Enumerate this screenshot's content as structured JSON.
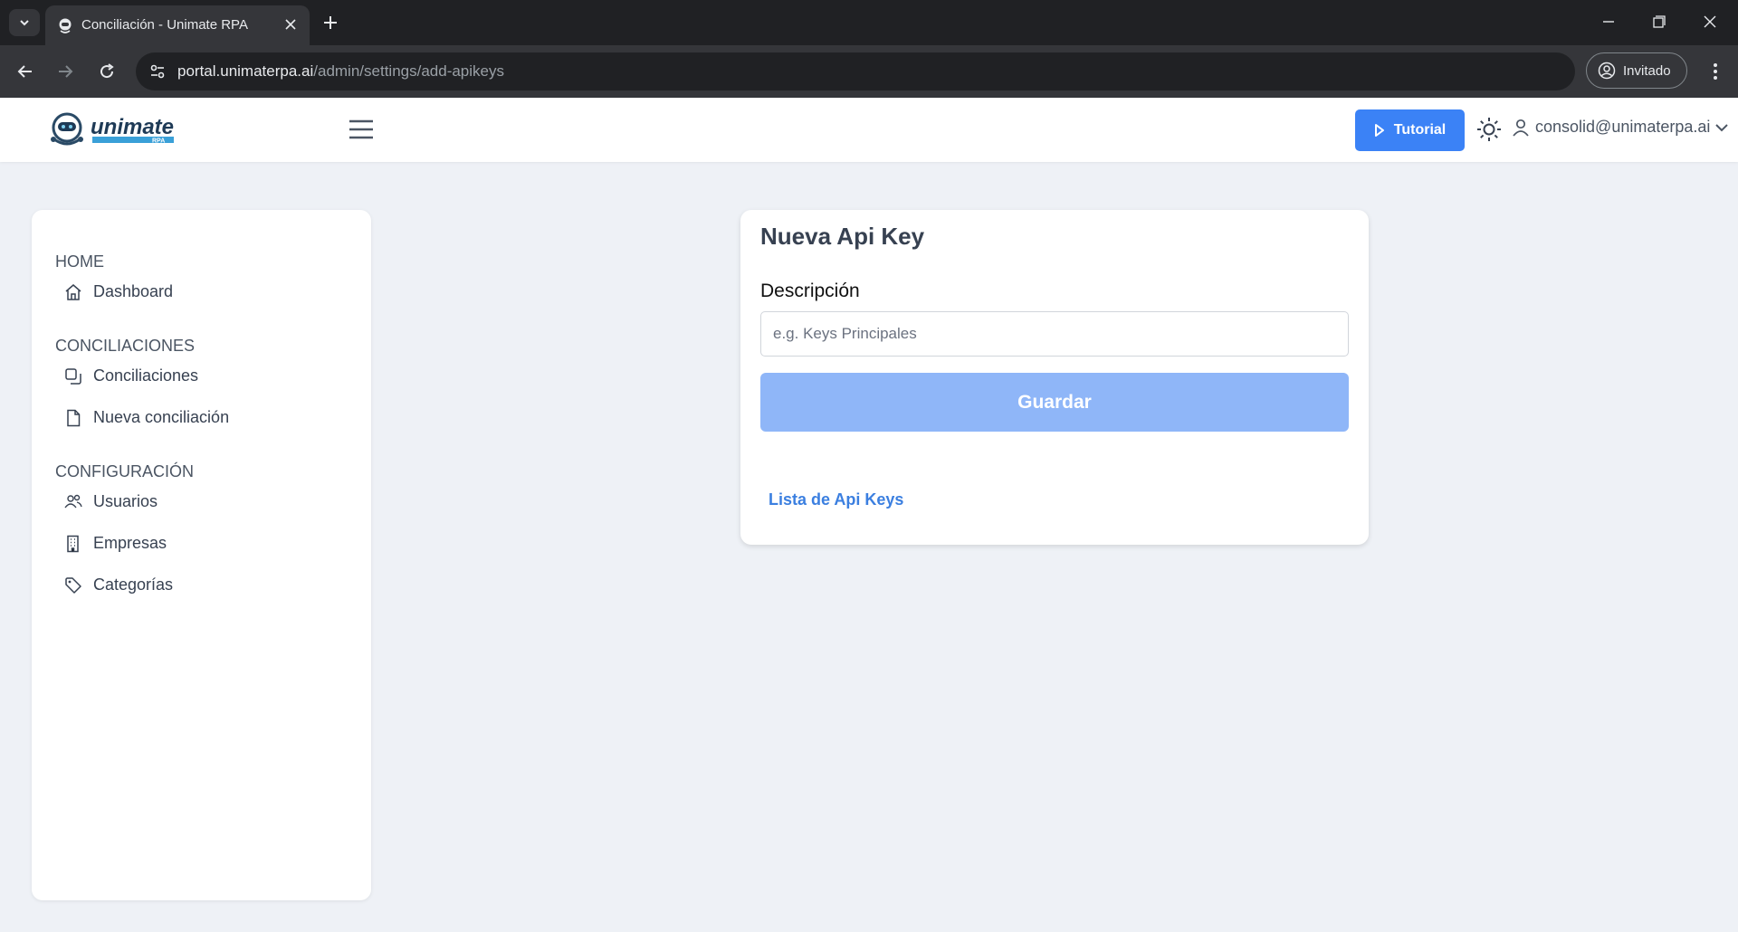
{
  "browser": {
    "tab_title": "Conciliación - Unimate RPA",
    "url_host": "portal.unimaterpa.ai",
    "url_path": "/admin/settings/add-apikeys",
    "profile_label": "Invitado"
  },
  "header": {
    "logo_text": "unimate",
    "logo_subtext": "RPA",
    "tutorial_label": "Tutorial",
    "user_email": "consolid@unimaterpa.ai"
  },
  "sidebar": {
    "sections": [
      {
        "title": "HOME",
        "items": [
          {
            "label": "Dashboard",
            "icon": "home-icon"
          }
        ]
      },
      {
        "title": "CONCILIACIONES",
        "items": [
          {
            "label": "Conciliaciones",
            "icon": "copy-icon"
          },
          {
            "label": "Nueva conciliación",
            "icon": "file-icon"
          }
        ]
      },
      {
        "title": "CONFIGURACIÓN",
        "items": [
          {
            "label": "Usuarios",
            "icon": "users-icon"
          },
          {
            "label": "Empresas",
            "icon": "building-icon"
          },
          {
            "label": "Categorías",
            "icon": "tag-icon"
          }
        ]
      }
    ]
  },
  "form": {
    "title": "Nueva Api Key",
    "description_label": "Descripción",
    "description_placeholder": "e.g. Keys Principales",
    "description_value": "",
    "save_label": "Guardar",
    "list_link": "Lista de Api Keys"
  },
  "colors": {
    "primary": "#3b82f6",
    "save_disabled": "#8fb6f8",
    "page_bg": "#eef1f6",
    "link": "#3b7fe0"
  }
}
